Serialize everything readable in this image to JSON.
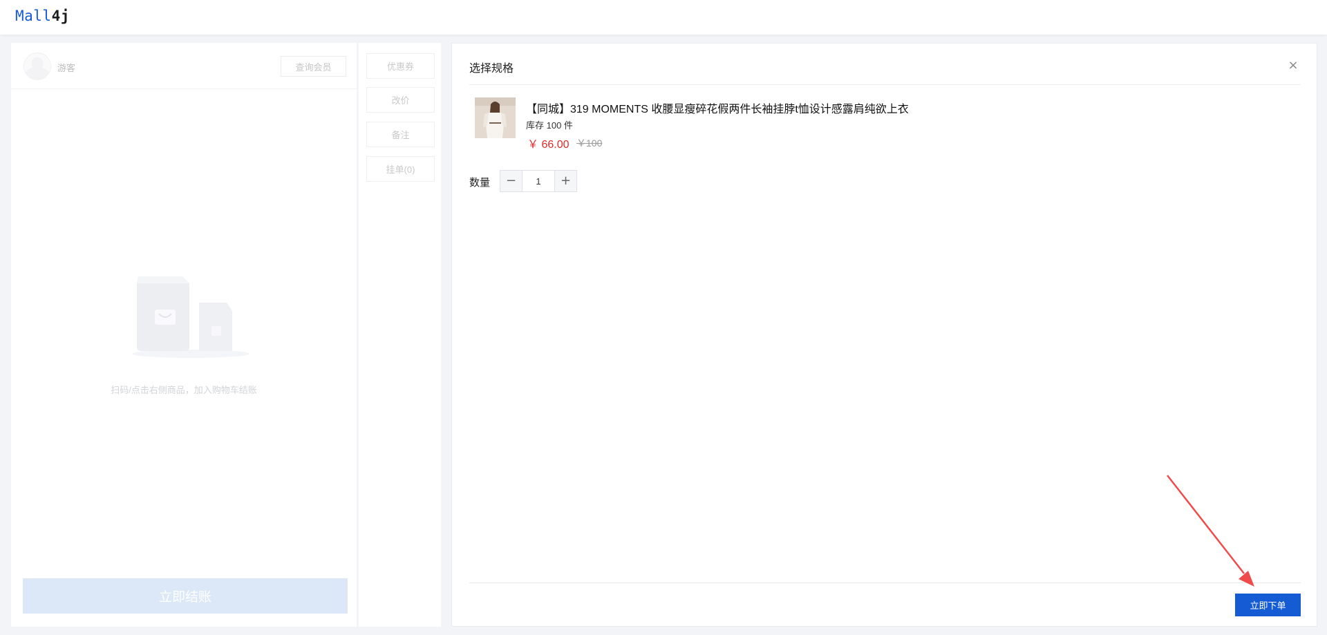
{
  "app": {
    "logo_part1": "Mall",
    "logo_part2": "4j"
  },
  "member": {
    "guest_label": "游客",
    "query_button": "查询会员"
  },
  "cart": {
    "empty_text": "扫码/点击右侧商品，加入购物车结账",
    "checkout_button": "立即结账"
  },
  "side_actions": [
    {
      "label": "优惠券"
    },
    {
      "label": "改价"
    },
    {
      "label": "备注"
    },
    {
      "label": "挂单(0)"
    }
  ],
  "dialog": {
    "title": "选择规格",
    "close": "×",
    "product": {
      "name": "【同城】319 MOMENTS 收腰显瘦碎花假两件长袖挂脖t恤设计感露肩纯欲上衣",
      "stock": "库存 100 件",
      "price": "￥ 66.00",
      "original_price": "￥100"
    },
    "quantity": {
      "label": "数量",
      "value": "1",
      "minus": "−",
      "plus": "+"
    },
    "order_button": "立即下单"
  },
  "colors": {
    "primary": "#155bd4",
    "price": "#e22a2a",
    "annotation_arrow": "#f04b4b"
  }
}
